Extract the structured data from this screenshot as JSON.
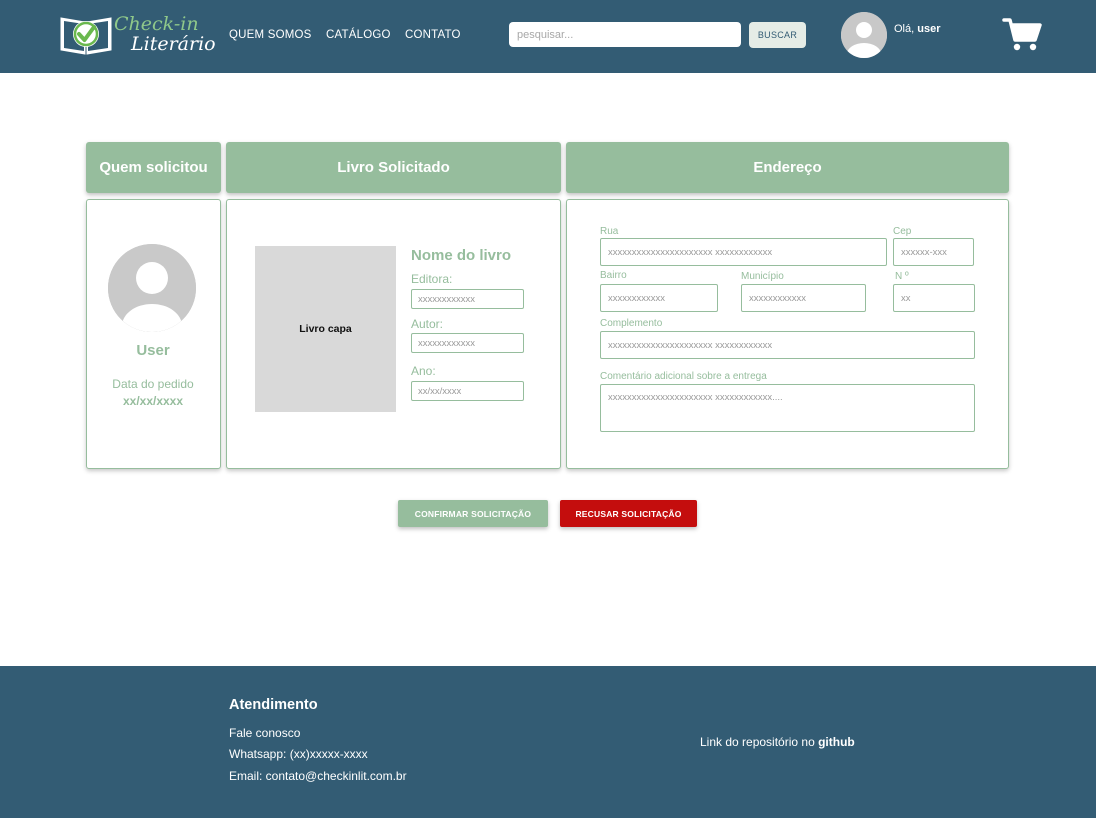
{
  "header": {
    "logo_line1": "Check-in",
    "logo_line2": "Literário",
    "nav": [
      "QUEM SOMOS",
      "CATÁLOGO",
      "CONTATO"
    ],
    "search_placeholder": "pesquisar...",
    "search_button": "BUSCAR",
    "greeting_prefix": "Olá, ",
    "username": "user"
  },
  "panels": {
    "requester_title": "Quem solicitou",
    "book_title": "Livro Solicitado",
    "address_title": "Endereço"
  },
  "requester": {
    "name": "User",
    "date_label": "Data do pedido",
    "date_value": "xx/xx/xxxx"
  },
  "book": {
    "cover_label": "Livro capa",
    "name": "Nome do livro",
    "publisher_label": "Editora:",
    "publisher_value": "xxxxxxxxxxxx",
    "author_label": "Autor:",
    "author_value": "xxxxxxxxxxxx",
    "year_label": "Ano:",
    "year_value": "xx/xx/xxxx"
  },
  "address": {
    "street_label": "Rua",
    "street_value": "xxxxxxxxxxxxxxxxxxxxxx xxxxxxxxxxxx",
    "zip_label": "Cep",
    "zip_value": "xxxxxx-xxx",
    "district_label": "Bairro",
    "district_value": "xxxxxxxxxxxx",
    "city_label": "Município",
    "city_value": "xxxxxxxxxxxx",
    "number_label": "N º",
    "number_value": "xx",
    "complement_label": "Complemento",
    "complement_value": "xxxxxxxxxxxxxxxxxxxxxx xxxxxxxxxxxx",
    "comment_label": "Comentário adicional sobre a entrega",
    "comment_value": "xxxxxxxxxxxxxxxxxxxxxx xxxxxxxxxxxx...."
  },
  "actions": {
    "confirm": "CONFIRMAR SOLICITAÇÃO",
    "refuse": "RECUSAR SOLICITAÇÃO"
  },
  "footer": {
    "title": "Atendimento",
    "contact": "Fale conosco",
    "whatsapp": "Whatsapp: (xx)xxxxx-xxxx",
    "email": "Email: contato@checkinlit.com.br",
    "repo_text": "Link do repositório no ",
    "repo_link": "github"
  },
  "colors": {
    "header_bg": "#335c74",
    "accent_green": "#96bd9d",
    "refuse_red": "#c40d0d"
  },
  "icons": [
    "book-check-logo-icon",
    "user-avatar-icon",
    "shopping-cart-icon"
  ]
}
